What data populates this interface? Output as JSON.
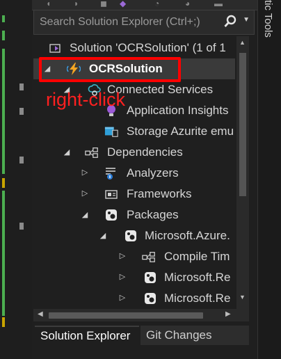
{
  "search": {
    "placeholder": "Search Solution Explorer (Ctrl+;)"
  },
  "tree": {
    "solution_label": "Solution 'OCRSolution' (1 of 1",
    "items": [
      {
        "label": "OCRSolution",
        "icon": "azure-functions-project-icon",
        "expanded": true,
        "selected": true
      },
      {
        "label": "Connected Services",
        "icon": "connected-services-icon",
        "expanded": true
      },
      {
        "label": "Application Insights",
        "icon": "application-insights-icon"
      },
      {
        "label": "Storage Azurite emu",
        "icon": "storage-azurite-icon"
      },
      {
        "label": "Dependencies",
        "icon": "dependencies-icon",
        "expanded": true
      },
      {
        "label": "Analyzers",
        "icon": "analyzers-icon",
        "expanded": false
      },
      {
        "label": "Frameworks",
        "icon": "frameworks-icon",
        "expanded": false
      },
      {
        "label": "Packages",
        "icon": "packages-icon",
        "expanded": true
      },
      {
        "label": "Microsoft.Azure.",
        "icon": "nuget-package-icon",
        "expanded": true
      },
      {
        "label": "Compile Tim",
        "icon": "compile-time-icon",
        "expanded": false
      },
      {
        "label": "Microsoft.Re",
        "icon": "nuget-package-icon",
        "expanded": false
      },
      {
        "label": "Microsoft.Re",
        "icon": "nuget-package-icon",
        "expanded": false
      }
    ]
  },
  "annotation": {
    "text": "right-click",
    "color": "#ff2020"
  },
  "tabs": [
    {
      "label": "Solution Explorer",
      "active": true
    },
    {
      "label": "Git Changes",
      "active": false
    }
  ],
  "side_panel": {
    "label": "tic Tools"
  },
  "colors": {
    "background": "#1f1f1f",
    "highlight": "#ff0000",
    "selected_row": "#3a3a3a"
  }
}
